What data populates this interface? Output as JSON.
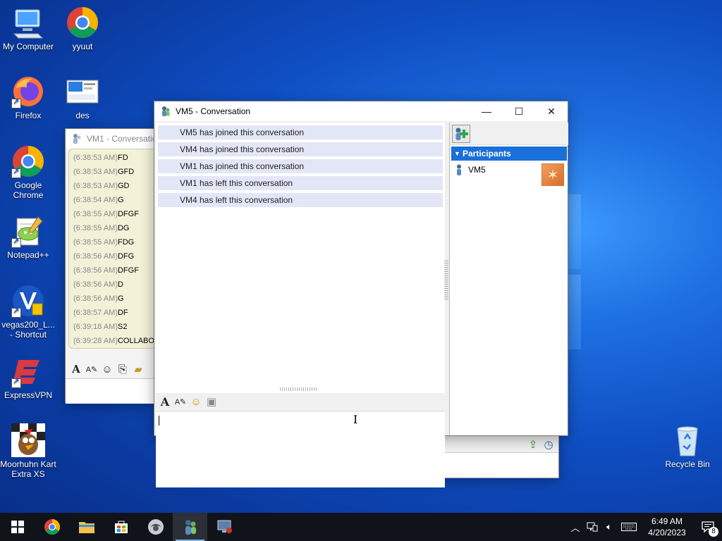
{
  "desktop": {
    "icons": [
      {
        "label": "My Computer"
      },
      {
        "label": "yyuut"
      },
      {
        "label": "Firefox"
      },
      {
        "label": "des"
      },
      {
        "label": "Google Chrome"
      },
      {
        "label": "Notepad++"
      },
      {
        "label": "vegas200_L... - Shortcut"
      },
      {
        "label": "ExpressVPN"
      },
      {
        "label": "Moorhuhn Kart Extra XS"
      },
      {
        "label": "Recycle Bin"
      }
    ]
  },
  "vm1_window": {
    "title": "VM1 - Conversatio",
    "log": [
      {
        "time": "(6:38:53 AM)",
        "text": "FD"
      },
      {
        "time": "(6:38:53 AM)",
        "text": "GFD"
      },
      {
        "time": "(6:38:53 AM)",
        "text": "GD"
      },
      {
        "time": "(6:38:54 AM)",
        "text": "G"
      },
      {
        "time": "(6:38:55 AM)",
        "text": "DFGF"
      },
      {
        "time": "(6:38:55 AM)",
        "text": "DG"
      },
      {
        "time": "(6:38:55 AM)",
        "text": "FDG"
      },
      {
        "time": "(6:38:56 AM)",
        "text": "DFG"
      },
      {
        "time": "(6:38:56 AM)",
        "text": "DFGF"
      },
      {
        "time": "(6:38:56 AM)",
        "text": "D"
      },
      {
        "time": "(6:38:56 AM)",
        "text": "G"
      },
      {
        "time": "(6:38:57 AM)",
        "text": "DF"
      },
      {
        "time": "(6:39:18 AM)",
        "text": "S2"
      },
      {
        "time": "(6:39:28 AM)",
        "text": "COLLABO"
      }
    ]
  },
  "conversation": {
    "title": "VM5 - Conversation",
    "controls": {
      "minimize": "—",
      "maximize": "☐",
      "close": "✕"
    },
    "messages": [
      "VM5 has joined this conversation",
      "VM4 has joined this conversation",
      "VM1 has joined this conversation",
      "VM1 has left this conversation",
      "VM4 has left this conversation"
    ],
    "input_value": "",
    "participants_header": "Participants",
    "participants": [
      "VM5"
    ]
  },
  "taskbar": {
    "time": "6:49 AM",
    "date": "4/20/2023",
    "notification_count": "8"
  },
  "colors": {
    "accent": "#1a6fd8",
    "message_bg": "#e3e6f6",
    "log_bg": "#f3f2d9"
  }
}
